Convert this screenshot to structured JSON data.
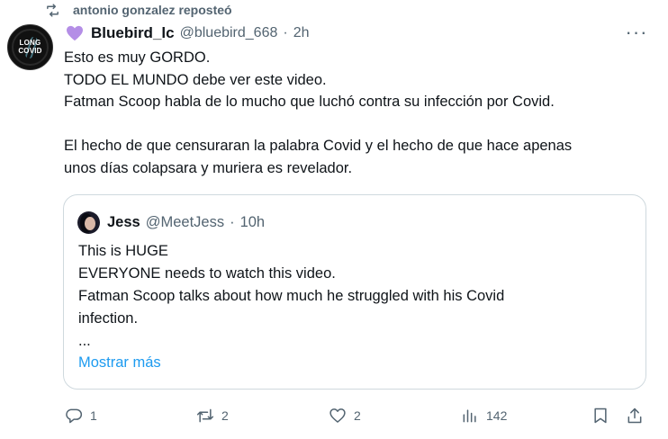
{
  "repost": {
    "icon": "repost-icon",
    "text": "antonio gonzalez reposteó"
  },
  "tweet": {
    "avatar_text": "LONG COVID",
    "name_icon": "purple-heart-icon",
    "display_name": "Bluebird_lc",
    "handle": "@bluebird_668",
    "separator": "·",
    "time": "2h",
    "more_icon": "more-icon",
    "lines": [
      "Esto es muy GORDO.",
      "TODO EL MUNDO debe ver este video.",
      "Fatman Scoop habla de lo mucho que luchó contra su infección por Covid.",
      "",
      "El hecho de que censuraran la palabra Covid y el hecho de que hace apenas",
      "unos días colapsara y muriera es revelador."
    ]
  },
  "quote": {
    "display_name": "Jess",
    "handle": "@MeetJess",
    "separator": "·",
    "time": "10h",
    "lines": [
      "This is HUGE",
      "EVERYONE needs to watch this video.",
      "Fatman Scoop talks about how much he struggled with his Covid",
      "infection.",
      "..."
    ],
    "show_more": "Mostrar más"
  },
  "actions": {
    "reply": {
      "icon": "reply-icon",
      "count": "1"
    },
    "repost": {
      "icon": "repost-icon",
      "count": "2"
    },
    "like": {
      "icon": "heart-icon",
      "count": "2"
    },
    "views": {
      "icon": "views-icon",
      "count": "142"
    },
    "bookmark": {
      "icon": "bookmark-icon"
    },
    "share": {
      "icon": "share-icon"
    }
  },
  "colors": {
    "text_primary": "#0f1419",
    "text_secondary": "#536471",
    "link": "#1d9bf0",
    "border": "#cfd9de",
    "heart_purple": "#b48ee6"
  }
}
